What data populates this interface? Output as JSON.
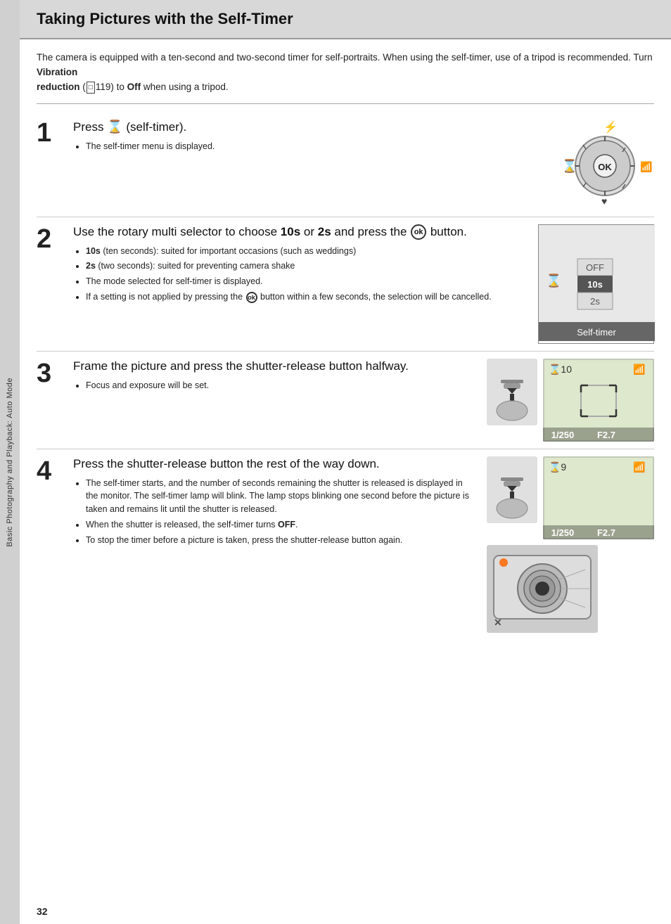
{
  "page": {
    "number": "32",
    "sidebar_label": "Basic Photography and Playback: Auto Mode"
  },
  "header": {
    "title": "Taking Pictures with the Self-Timer"
  },
  "intro": {
    "text_before_bold": "The camera is equipped with a ten-second and two-second timer for self-portraits. When using the self-timer, use of a tripod is recommended. Turn ",
    "bold_text": "Vibration reduction",
    "book_ref": "119",
    "text_after": " to ",
    "off_bold": "Off",
    "text_end": " when using a tripod."
  },
  "steps": [
    {
      "number": "1",
      "title_plain": "Press ",
      "title_icon": "⏱",
      "title_after": " (self-timer).",
      "bullets": [
        "The self-timer menu is displayed."
      ]
    },
    {
      "number": "2",
      "title_before": "Use the rotary multi selector to choose ",
      "title_bold1": "10s",
      "title_mid": " or ",
      "title_bold2": "2s",
      "title_end": " and press the",
      "title_ok": "OK",
      "title_final": " button.",
      "bullets": [
        "10s (ten seconds): suited for important occasions (such as weddings)",
        "2s (two seconds): suited for preventing camera shake",
        "The mode selected for self-timer is displayed.",
        "If a setting is not applied by pressing the  button within a few seconds, the selection will be cancelled."
      ],
      "bullet_bold": [
        "10s",
        "2s"
      ],
      "menu_label": "Self-timer",
      "menu_items": [
        "OFF",
        "10s",
        "2s"
      ]
    },
    {
      "number": "3",
      "title": "Frame the picture and press the shutter-release button halfway.",
      "bullets": [
        "Focus and exposure will be set."
      ],
      "viewfinder": {
        "timer": "🕐10",
        "shutter": "1/250",
        "aperture": "F2.7"
      }
    },
    {
      "number": "4",
      "title": "Press the shutter-release button the rest of the way down.",
      "bullets": [
        "The self-timer starts, and the number of seconds remaining the shutter is released is displayed in the monitor. The self-timer lamp will blink. The lamp stops blinking one second before the picture is taken and remains lit until the shutter is released.",
        "When the shutter is released, the self-timer turns OFF.",
        "To stop the timer before a picture is taken, press the shutter-release button again."
      ],
      "viewfinder": {
        "timer": "🕐9",
        "shutter": "1/250",
        "aperture": "F2.7"
      }
    }
  ]
}
